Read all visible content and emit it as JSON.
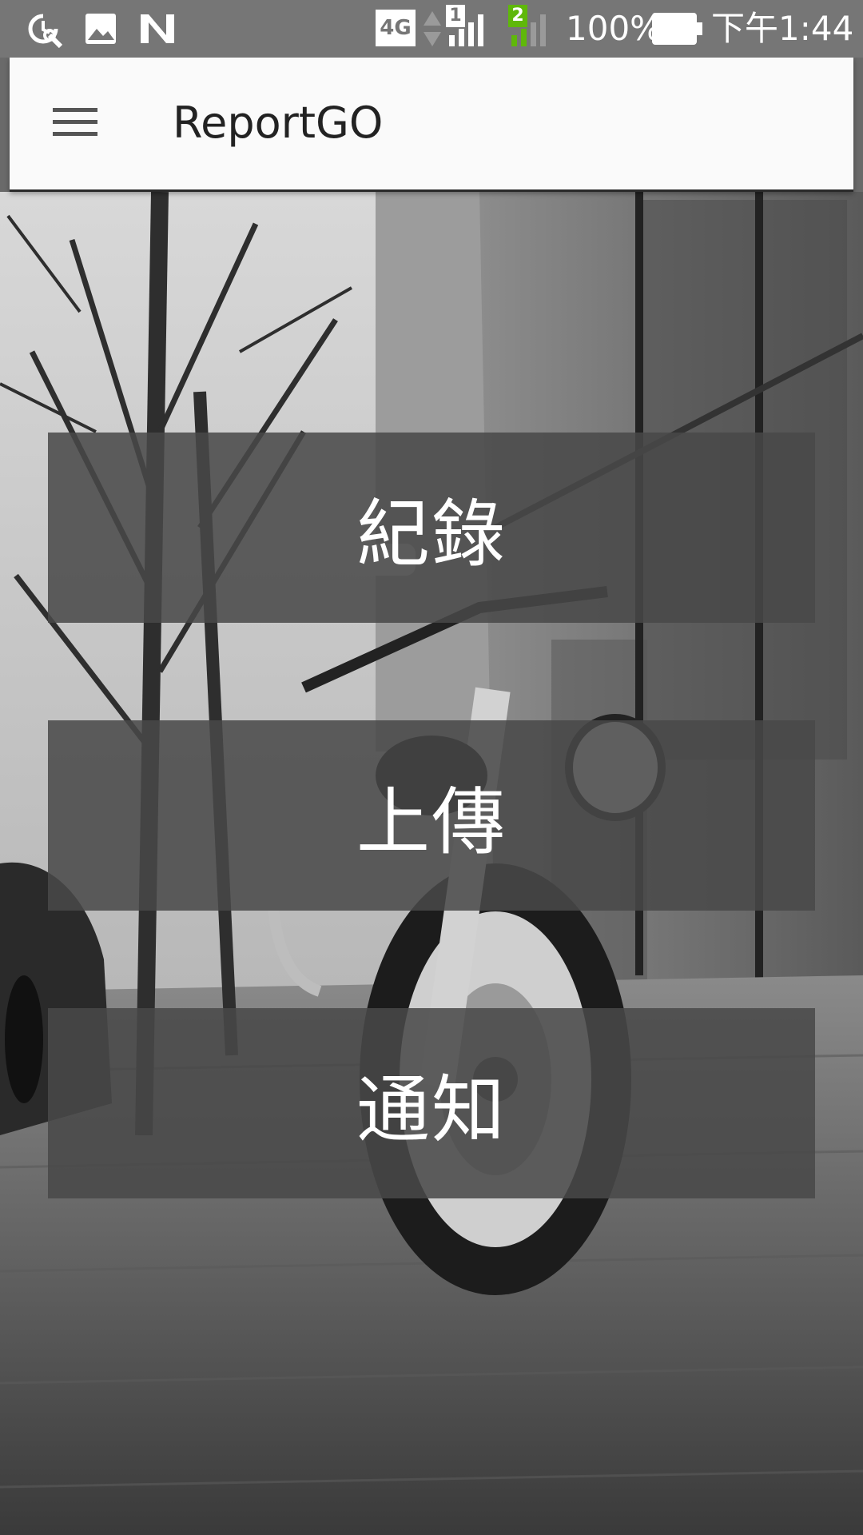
{
  "status_bar": {
    "network": "4G",
    "sim1": "1",
    "sim2": "2",
    "battery": "100%",
    "time": "下午1:44",
    "icons": [
      "alarm-wrench-icon",
      "image-icon",
      "n-app-icon",
      "data-arrows-icon",
      "signal-icon",
      "battery-icon"
    ]
  },
  "app_bar": {
    "title": "ReportGO",
    "menu_icon": "hamburger-menu-icon"
  },
  "menu": {
    "items": [
      {
        "label": "紀錄"
      },
      {
        "label": "上傳"
      },
      {
        "label": "通知"
      }
    ]
  },
  "colors": {
    "status_bar": "#767676",
    "app_bar": "#fafafa",
    "button_overlay": "#484848",
    "sim2_signal": "#5fb80a"
  }
}
